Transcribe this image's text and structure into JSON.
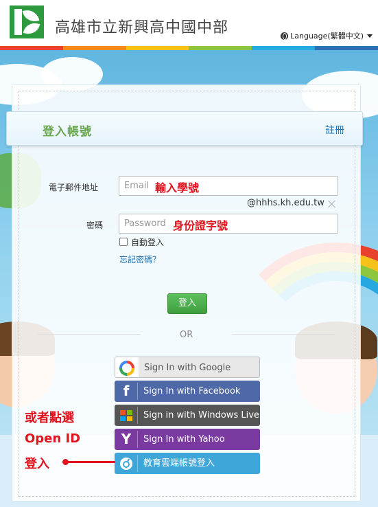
{
  "header": {
    "site_title": "高雄市立新興高中國中部",
    "language_label": "Language(繁體中文)"
  },
  "rainbow_colors": [
    "#e8412e",
    "#f28a1e",
    "#f6c21a",
    "#8cc63f",
    "#27a8e0",
    "#2b6fb6"
  ],
  "panel": {
    "title": "登入帳號",
    "register_link": "註冊"
  },
  "form": {
    "email_label": "電子郵件地址",
    "email_placeholder": "Email",
    "email_hint": "輸入學號",
    "email_domain": "@hhhs.kh.edu.tw",
    "password_label": "密碼",
    "password_placeholder": "Password",
    "password_hint": "身份證字號",
    "remember_label": "自動登入",
    "forgot_link": "忘記密碼？",
    "login_button": "登入",
    "or_text": "OR"
  },
  "sso": [
    {
      "label": "Sign In with Google",
      "icon": "google-icon",
      "color": "#e8e8e8",
      "text_color": "#555"
    },
    {
      "label": "Sign In with Facebook",
      "icon": "facebook-icon",
      "color": "#4e68a8",
      "text_color": "#fff"
    },
    {
      "label": "Sign in with Windows Live",
      "icon": "windows-icon",
      "color": "#555555",
      "text_color": "#fff"
    },
    {
      "label": "Sign In with Yahoo",
      "icon": "yahoo-icon",
      "color": "#7a3aa0",
      "text_color": "#fff"
    },
    {
      "label": "教育雲端帳號登入",
      "icon": "edu-cloud-icon",
      "color": "#3ea6d8",
      "text_color": "#fff"
    }
  ],
  "annotation": {
    "line1": "或者點選",
    "line2": "Open ID",
    "line3": "登入"
  }
}
